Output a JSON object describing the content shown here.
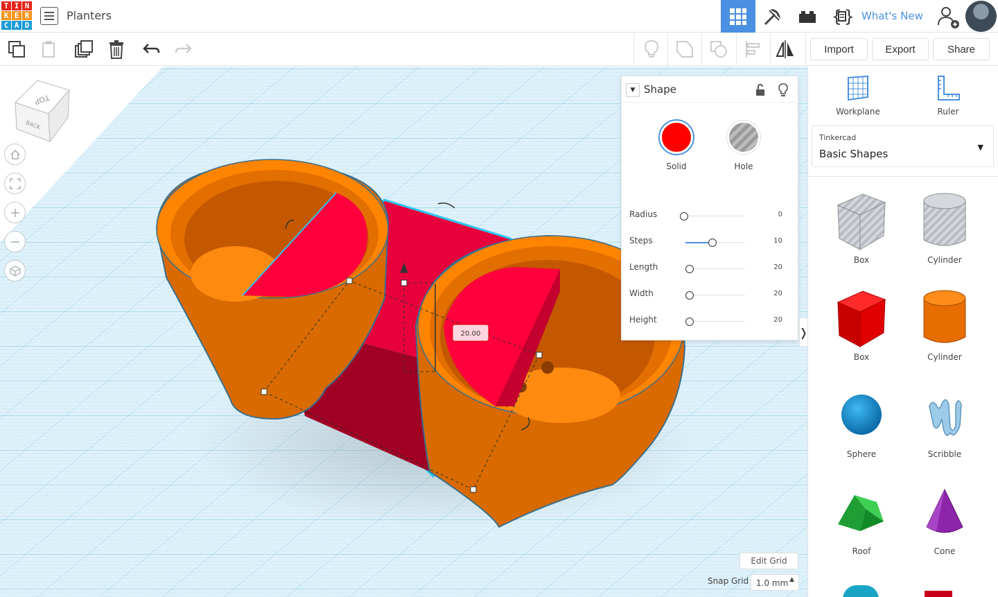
{
  "app": {
    "logo_letters": [
      "T",
      "I",
      "N",
      "K",
      "E",
      "R",
      "C",
      "A",
      "D"
    ],
    "logo_colors": [
      "#e2231a",
      "#e2231a",
      "#e2231a",
      "#f7941d",
      "#f7941d",
      "#f7941d",
      "#1a9bd7",
      "#1a9bd7",
      "#1a9bd7"
    ],
    "project_title": "Planters"
  },
  "topbar": {
    "icons": [
      "grid-view-icon",
      "pickaxe-icon",
      "bricks-icon",
      "codeblocks-icon"
    ],
    "whats_new_label": "What's New",
    "accent_color": "#4a90e2"
  },
  "toolbar": {
    "left_tools": [
      "copy-icon",
      "paste-icon",
      "duplicate-icon",
      "delete-icon",
      "undo-icon",
      "redo-icon"
    ],
    "right_tools": [
      "notes-icon",
      "group-icon",
      "ungroup-icon",
      "align-icon",
      "mirror-icon"
    ],
    "import_label": "Import",
    "export_label": "Export",
    "share_label": "Share"
  },
  "viewcube": {
    "top_label": "TOP",
    "back_label": "BACK"
  },
  "view_controls": [
    "home-view-icon",
    "fit-view-icon",
    "zoom-in-icon",
    "zoom-out-icon",
    "perspective-icon"
  ],
  "dimension_tooltip": "20.00",
  "inspector": {
    "title": "Shape",
    "solid_label": "Solid",
    "hole_label": "Hole",
    "solid_color": "#ff0000",
    "properties": [
      {
        "label": "Radius",
        "value": "0",
        "fraction": 0.0
      },
      {
        "label": "Steps",
        "value": "10",
        "fraction": 0.4
      },
      {
        "label": "Length",
        "value": "20",
        "fraction": 0.08
      },
      {
        "label": "Width",
        "value": "20",
        "fraction": 0.08
      },
      {
        "label": "Height",
        "value": "20",
        "fraction": 0.08
      }
    ]
  },
  "right_panel": {
    "workplane_label": "Workplane",
    "ruler_label": "Ruler",
    "library_category": "Tinkercad",
    "library_name": "Basic Shapes",
    "shapes": [
      {
        "label": "Box",
        "icon": "box-hole-icon"
      },
      {
        "label": "Cylinder",
        "icon": "cylinder-hole-icon"
      },
      {
        "label": "Box",
        "icon": "box-solid-icon"
      },
      {
        "label": "Cylinder",
        "icon": "cylinder-solid-icon"
      },
      {
        "label": "Sphere",
        "icon": "sphere-icon"
      },
      {
        "label": "Scribble",
        "icon": "scribble-icon"
      },
      {
        "label": "Roof",
        "icon": "roof-icon"
      },
      {
        "label": "Cone",
        "icon": "cone-icon"
      }
    ]
  },
  "grid_controls": {
    "edit_grid_label": "Edit Grid",
    "snap_grid_label": "Snap Grid",
    "snap_grid_value": "1.0 mm"
  }
}
